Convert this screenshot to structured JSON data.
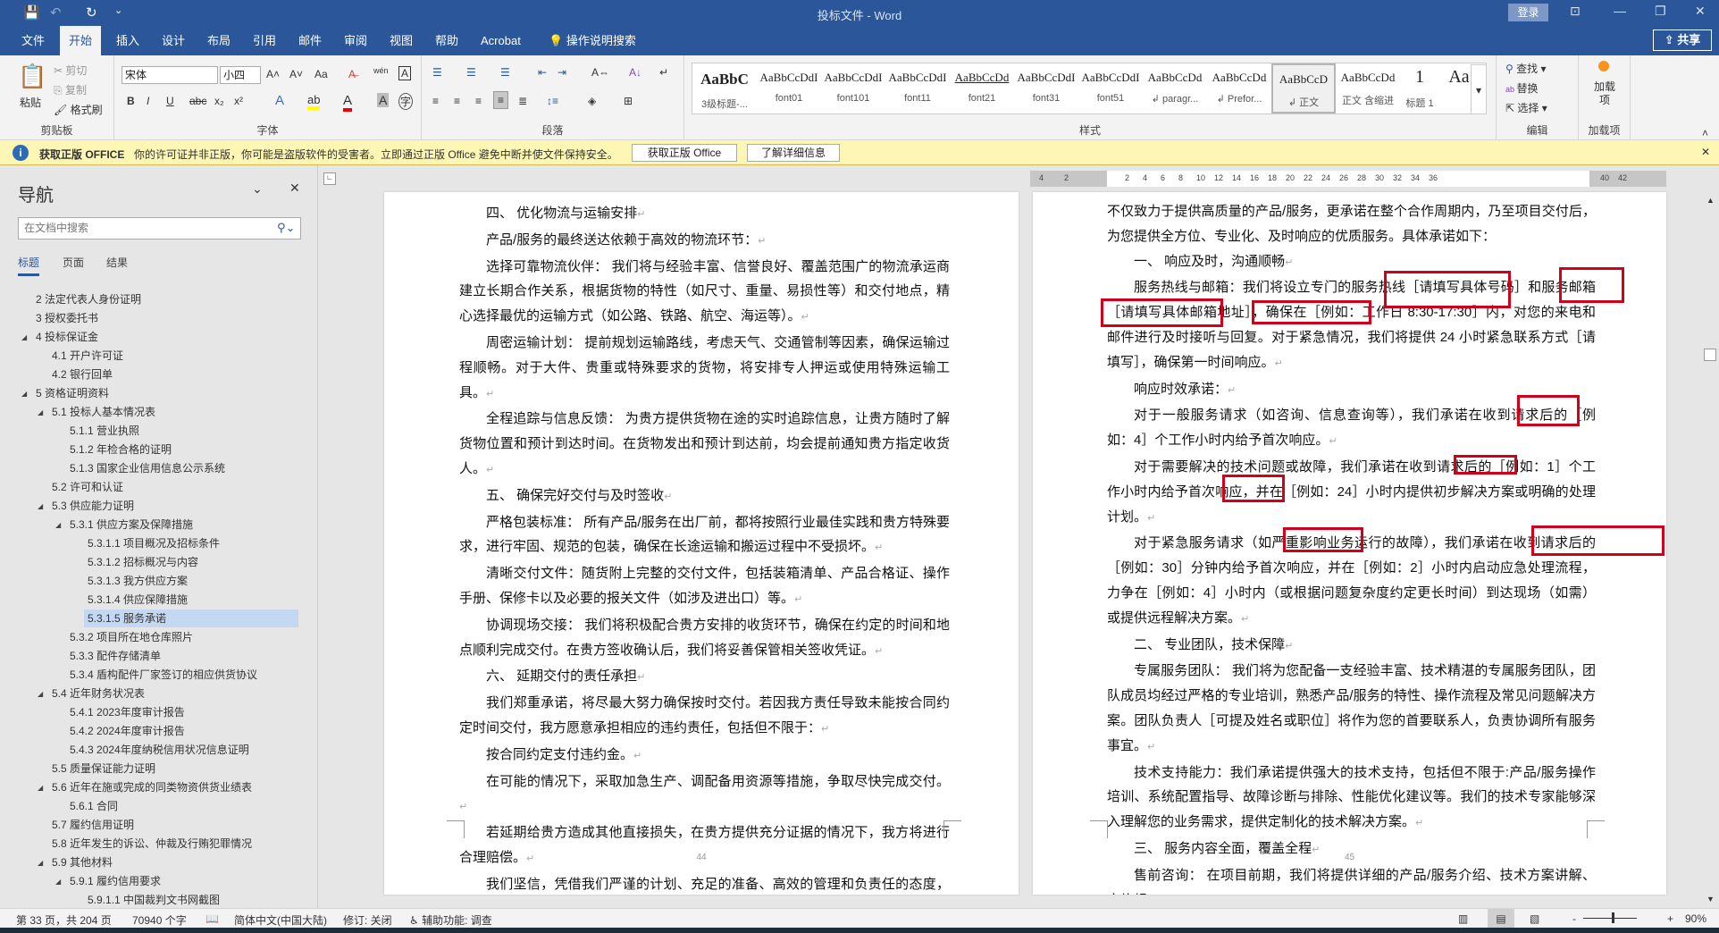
{
  "titlebar": {
    "title": "投标文件  -  Word",
    "login": "登录",
    "share": "共享",
    "qa_save": "💾",
    "qa_undo": "↶",
    "qa_redo": "↻",
    "qa_more": "⌄",
    "ribbon_display": "⊡",
    "minimize": "—",
    "restore": "❐",
    "close": "✕"
  },
  "tabs": [
    "文件",
    "开始",
    "插入",
    "设计",
    "布局",
    "引用",
    "邮件",
    "审阅",
    "视图",
    "帮助",
    "Acrobat",
    "操作说明搜索"
  ],
  "ribbon": {
    "clipboard": {
      "label": "剪贴板",
      "paste": "粘贴",
      "cut": "剪切",
      "copy": "复制",
      "format_painter": "格式刷"
    },
    "font": {
      "label": "字体",
      "font_name": "宋体",
      "font_size": "小四",
      "bold": "B",
      "italic": "I",
      "underline": "U",
      "strike": "abc",
      "sub": "x₂",
      "sup": "x²",
      "grow": "A˄",
      "shrink": "A˅",
      "case": "Aa",
      "clear": "A̶",
      "pinyin": "wén",
      "border": "A"
    },
    "paragraph": {
      "label": "段落",
      "bullets": "☰",
      "numbering": "☰",
      "multilevel": "☰",
      "sort": "A↓",
      "marks": "↵"
    },
    "styles": {
      "label": "样式",
      "items": [
        {
          "preview": "AaBbC",
          "name": "3级标题-..."
        },
        {
          "preview": "AaBbCcDdI",
          "name": "font01"
        },
        {
          "preview": "AaBbCcDdI",
          "name": "font101"
        },
        {
          "preview": "AaBbCcDdI",
          "name": "font11"
        },
        {
          "preview": "AaBbCcDd",
          "name": "font21"
        },
        {
          "preview": "AaBbCcDdI",
          "name": "font31"
        },
        {
          "preview": "AaBbCcDdI",
          "name": "font51"
        },
        {
          "preview": "AaBbCcDd",
          "name": "↲ paragr..."
        },
        {
          "preview": "AaBbCcDd",
          "name": "↲ Prefor..."
        },
        {
          "preview": "AaBbCcD",
          "name": "↲ 正文"
        },
        {
          "preview": "AaBbCcDd",
          "name": "正文 含缩进"
        },
        {
          "preview": "1",
          "name": "标题 1"
        },
        {
          "preview": "Aa",
          "name": ""
        }
      ]
    },
    "editing": {
      "label": "编辑",
      "find": "查找",
      "replace": "替换",
      "select": "选择"
    },
    "addins": {
      "label": "加载项",
      "button": "加载项"
    }
  },
  "infobar": {
    "title": "获取正版 OFFICE",
    "message": "你的许可证并非正版，你可能是盗版软件的受害者。立即通过正版 Office 避免中断并使文件保持安全。",
    "btn_get": "获取正版 Office",
    "btn_learn": "了解详细信息"
  },
  "nav": {
    "title": "导航",
    "search_placeholder": "在文档中搜索",
    "tabs": [
      "标题",
      "页面",
      "结果"
    ],
    "items": [
      {
        "label": "2 法定代表人身份证明",
        "level": 1,
        "tri": false
      },
      {
        "label": "3 授权委托书",
        "level": 1,
        "tri": false
      },
      {
        "label": "4 投标保证金",
        "level": 1,
        "tri": true
      },
      {
        "label": "4.1 开户许可证",
        "level": 2,
        "tri": false
      },
      {
        "label": "4.2 银行回单",
        "level": 2,
        "tri": false
      },
      {
        "label": "5 资格证明资料",
        "level": 1,
        "tri": true
      },
      {
        "label": "5.1 投标人基本情况表",
        "level": 2,
        "tri": true
      },
      {
        "label": "5.1.1 营业执照",
        "level": 3,
        "tri": false
      },
      {
        "label": "5.1.2 年检合格的证明",
        "level": 3,
        "tri": false
      },
      {
        "label": "5.1.3 国家企业信用信息公示系统",
        "level": 3,
        "tri": false
      },
      {
        "label": "5.2 许可和认证",
        "level": 2,
        "tri": false
      },
      {
        "label": "5.3 供应能力证明",
        "level": 2,
        "tri": true
      },
      {
        "label": "5.3.1 供应方案及保障措施",
        "level": 3,
        "tri": true
      },
      {
        "label": "5.3.1.1 项目概况及招标条件",
        "level": 4,
        "tri": false
      },
      {
        "label": "5.3.1.2 招标概况与内容",
        "level": 4,
        "tri": false
      },
      {
        "label": "5.3.1.3 我方供应方案",
        "level": 4,
        "tri": false
      },
      {
        "label": "5.3.1.4 供应保障措施",
        "level": 4,
        "tri": false
      },
      {
        "label": "5.3.1.5 服务承诺",
        "level": 4,
        "tri": false,
        "selected": true
      },
      {
        "label": "5.3.2 项目所在地仓库照片",
        "level": 3,
        "tri": false
      },
      {
        "label": "5.3.3 配件存储清单",
        "level": 3,
        "tri": false
      },
      {
        "label": "5.3.4 盾构配件厂家签订的相应供货协议",
        "level": 3,
        "tri": false
      },
      {
        "label": "5.4 近年财务状况表",
        "level": 2,
        "tri": true
      },
      {
        "label": "5.4.1 2023年度审计报告",
        "level": 3,
        "tri": false
      },
      {
        "label": "5.4.2 2024年度审计报告",
        "level": 3,
        "tri": false
      },
      {
        "label": "5.4.3 2024年度纳税信用状况信息证明",
        "level": 3,
        "tri": false
      },
      {
        "label": "5.5 质量保证能力证明",
        "level": 2,
        "tri": false
      },
      {
        "label": "5.6 近年在施或完成的同类物资供货业绩表",
        "level": 2,
        "tri": true
      },
      {
        "label": "5.6.1 合同",
        "level": 3,
        "tri": false
      },
      {
        "label": "5.7 履约信用证明",
        "level": 2,
        "tri": false
      },
      {
        "label": "5.8 近年发生的诉讼、仲裁及行贿犯罪情况",
        "level": 2,
        "tri": false
      },
      {
        "label": "5.9 其他材料",
        "level": 2,
        "tri": true
      },
      {
        "label": "5.9.1 履约信用要求",
        "level": 3,
        "tri": true
      },
      {
        "label": "5.9.1.1 中国裁判文书网截图",
        "level": 4,
        "tri": false
      }
    ]
  },
  "ruler": [
    "4",
    "2",
    "2",
    "4",
    "6",
    "8",
    "10",
    "12",
    "14",
    "16",
    "18",
    "20",
    "22",
    "24",
    "26",
    "28",
    "30",
    "32",
    "34",
    "36",
    "40",
    "42"
  ],
  "page_left": {
    "number": "44",
    "paragraphs": [
      "四、  优化物流与运输安排",
      "产品/服务的最终送达依赖于高效的物流环节：",
      "选择可靠物流伙伴： 我们将与经验丰富、信誉良好、覆盖范围广的物流承运商建立长期合作关系，根据货物的特性（如尺寸、重量、易损性等）和交付地点，精心选择最优的运输方式（如公路、铁路、航空、海运等）。",
      "周密运输计划： 提前规划运输路线，考虑天气、交通管制等因素，确保运输过程顺畅。对于大件、贵重或特殊要求的货物，将安排专人押运或使用特殊运输工具。",
      "全程追踪与信息反馈： 为贵方提供货物在途的实时追踪信息，让贵方随时了解货物位置和预计到达时间。在货物发出和预计到达前，均会提前通知贵方指定收货人。",
      "五、  确保完好交付与及时签收",
      "严格包装标准： 所有产品/服务在出厂前，都将按照行业最佳实践和贵方特殊要求，进行牢固、规范的包装，确保在长途运输和搬运过程中不受损坏。",
      "清晰交付文件：随货附上完整的交付文件，包括装箱清单、产品合格证、操作手册、保修卡以及必要的报关文件（如涉及进出口）等。",
      "协调现场交接： 我们将积极配合贵方安排的收货环节，确保在约定的时间和地点顺利完成交付。在贵方签收确认后，我们将妥善保管相关签收凭证。",
      "六、  延期交付的责任承担",
      "我们郑重承诺，将尽最大努力确保按时交付。若因我方责任导致未能按合同约定时间交付，我方愿意承担相应的违约责任，包括但不限于：",
      "按合同约定支付违约金。",
      "在可能的情况下，采取加急生产、调配备用资源等措施，争取尽快完成交付。",
      "若延期给贵方造成其他直接损失，在贵方提供充分证据的情况下，我方将进行合理赔偿。",
      "我们坚信，凭借我们严谨的计划、充足的准备、高效的管理和负责任的态度，一定能"
    ]
  },
  "page_right": {
    "number": "45",
    "first_line": "不仅致力于提供高质量的产品/服务，更承诺在整个合作周期内，乃至项目交付后，为您提供全方位、专业化、及时响应的优质服务。具体承诺如下：",
    "paragraphs": [
      "一、  响应及时，沟通顺畅",
      "服务热线与邮箱：我们将设立专门的服务热线［请填写具体号码］和服务邮箱［请填写具体邮箱地址］，确保在［例如：工作日 8:30-17:30］内，对您的来电和邮件进行及时接听与回复。对于紧急情况，我们将提供 24 小时紧急联系方式［请填写］，确保第一时间响应。",
      "响应时效承诺：",
      "对于一般服务请求（如咨询、信息查询等），我们承诺在收到请求后的［例如：4］个工作小时内给予首次响应。",
      "对于需要解决的技术问题或故障，我们承诺在收到请求后的［例如：1］个工作小时内给予首次响应，并在［例如：24］小时内提供初步解决方案或明确的处理计划。",
      "对于紧急服务请求（如严重影响业务运行的故障），我们承诺在收到请求后的［例如：30］分钟内给予首次响应，并在［例如：2］小时内启动应急处理流程，力争在［例如：4］小时内（或根据问题复杂度约定更长时间）到达现场（如需）或提供远程解决方案。",
      "二、  专业团队，技术保障",
      "专属服务团队： 我们将为您配备一支经验丰富、技术精湛的专属服务团队，团队成员均经过严格的专业培训，熟悉产品/服务的特性、操作流程及常见问题解决方案。团队负责人［可提及姓名或职位］将作为您的首要联系人，负责协调所有服务事宜。",
      "技术支持能力：我们承诺提供强大的技术支持，包括但不限于:产品/服务操作培训、系统配置指导、故障诊断与排除、性能优化建议等。我们的技术专家能够深入理解您的业务需求，提供定制化的技术解决方案。",
      "三、  服务内容全面，覆盖全程",
      "售前咨询： 在项目前期，我们将提供详细的产品/服务介绍、技术方案讲解、实施规"
    ]
  },
  "status": {
    "page": "第 33 页，共 204 页",
    "words": "70940 个字",
    "language": "简体中文(中国大陆)",
    "track": "修订: 关闭",
    "accessibility": "辅助功能: 调查",
    "zoom": "90%",
    "zoom_minus": "-",
    "zoom_plus": "+"
  },
  "colors": {
    "brand": "#2b579a",
    "highlight": "#d0021b",
    "infobar": "#fdf6b4"
  }
}
